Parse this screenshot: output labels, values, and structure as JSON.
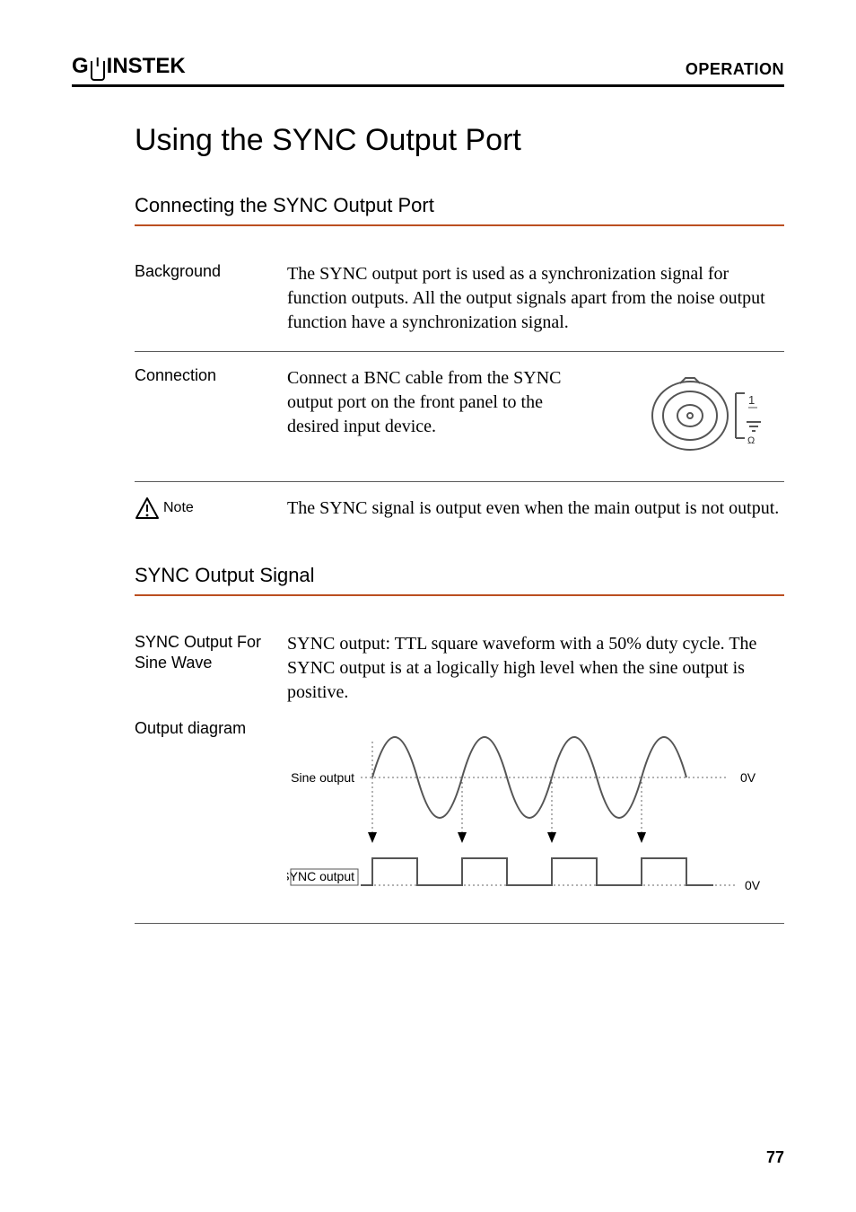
{
  "header": {
    "brand_prefix": "G",
    "brand_suffix": "INSTEK",
    "chapter": "OPERATION"
  },
  "section_title": "Using the SYNC Output Port",
  "sub1_title": "Connecting the SYNC Output Port",
  "rows": {
    "background": {
      "label": "Background",
      "text": "The SYNC output port is used as a synchronization signal for function outputs. All the output signals apart from the noise output function have a synchronization signal."
    },
    "connection": {
      "label": "Connection",
      "text": "Connect a BNC cable from the SYNC output port on the front panel to the desired input device."
    },
    "note": {
      "label": "Note",
      "text": "The SYNC signal is output even when the main output is not output."
    }
  },
  "sub2_title": "SYNC Output Signal",
  "rows2": {
    "sine": {
      "label": "SYNC Output For Sine Wave",
      "text": "SYNC output: TTL square waveform with a 50% duty cycle. The SYNC output is at a logically high level when the sine output is positive."
    },
    "diagram": {
      "label": "Output diagram",
      "sine_label": "Sine output",
      "sync_label": "SYNC output",
      "zero_label": "0V"
    }
  },
  "page_number": "77"
}
